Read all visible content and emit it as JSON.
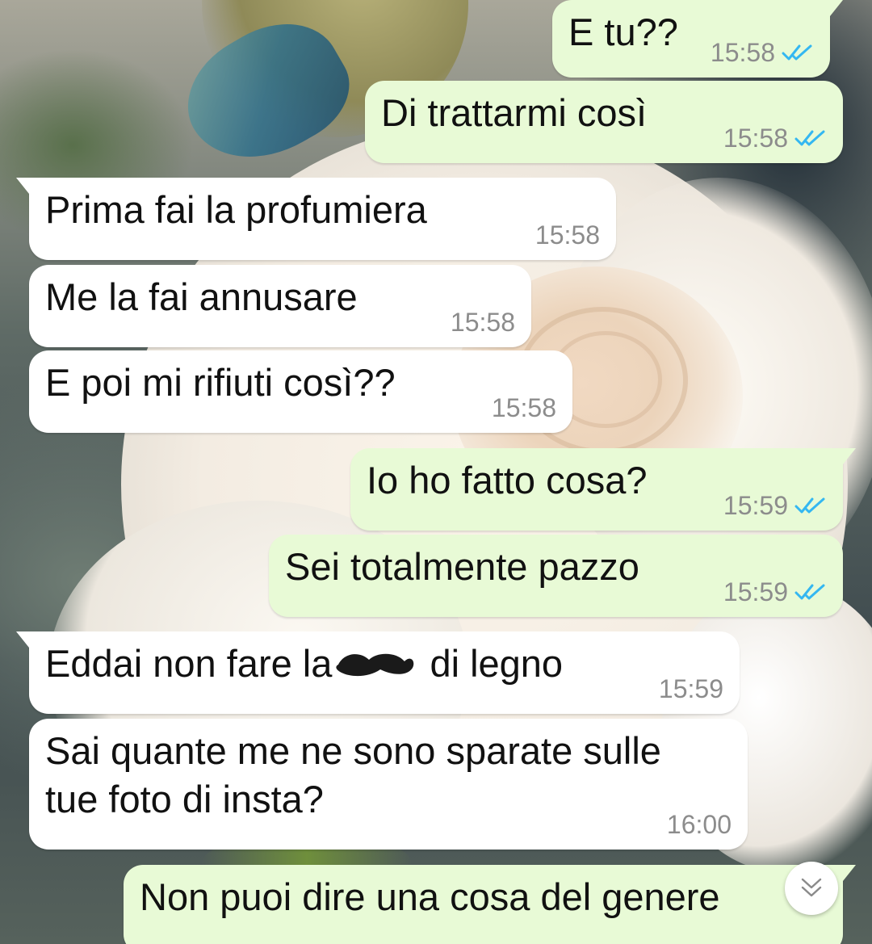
{
  "theme": {
    "incoming_bubble": "#ffffff",
    "outgoing_bubble": "#e8fad6",
    "read_tick_color": "#34b7f1",
    "time_color": "#8c8c8c"
  },
  "messages": [
    {
      "text": "E tu??",
      "time": "15:58",
      "direction": "out",
      "status": "read"
    },
    {
      "text": "Di trattarmi così",
      "time": "15:58",
      "direction": "out",
      "status": "read"
    },
    {
      "text": "Prima fai la profumiera",
      "time": "15:58",
      "direction": "in"
    },
    {
      "text": "Me la fai annusare",
      "time": "15:58",
      "direction": "in"
    },
    {
      "text": "E poi mi rifiuti così??",
      "time": "15:58",
      "direction": "in"
    },
    {
      "text": "Io ho fatto cosa?",
      "time": "15:59",
      "direction": "out",
      "status": "read"
    },
    {
      "text": "Sei totalmente pazzo",
      "time": "15:59",
      "direction": "out",
      "status": "read"
    },
    {
      "text_before": "Eddai non fare la",
      "text_after": "di legno",
      "redacted": true,
      "time": "15:59",
      "direction": "in"
    },
    {
      "text": "Sai quante me ne sono sparate sulle\ntue foto di insta?",
      "time": "16:00",
      "direction": "in"
    },
    {
      "text": "Non puoi dire una cosa del genere",
      "direction": "out"
    }
  ],
  "scroll_button": {
    "icon": "double-chevron-down-icon"
  }
}
